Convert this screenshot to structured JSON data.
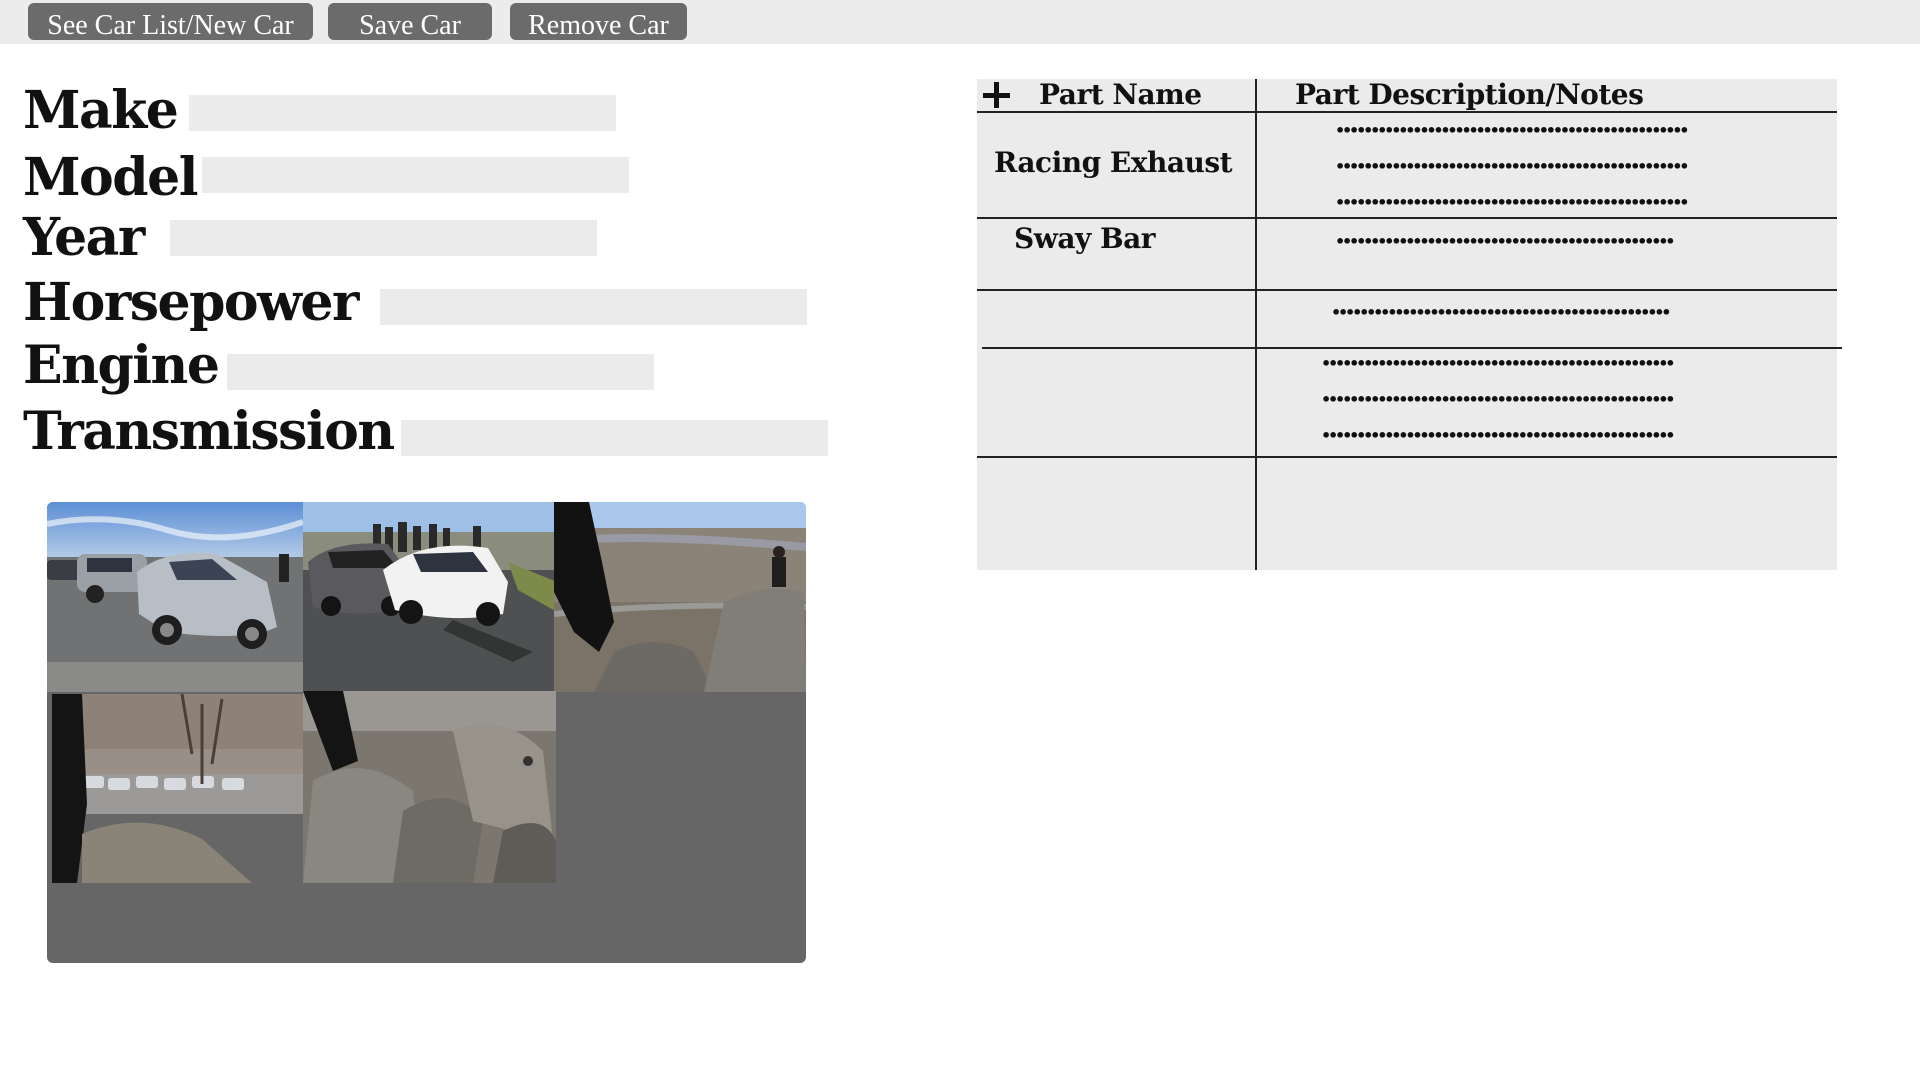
{
  "toolbar": {
    "see_car_list_label": "See Car List/New Car",
    "save_car_label": "Save Car",
    "remove_car_label": "Remove Car",
    "button_color": "#6b6b6b"
  },
  "fields": [
    {
      "label": "Make",
      "value": ""
    },
    {
      "label": "Model",
      "value": ""
    },
    {
      "label": "Year",
      "value": ""
    },
    {
      "label": "Horsepower",
      "value": ""
    },
    {
      "label": "Engine",
      "value": ""
    },
    {
      "label": "Transmission",
      "value": ""
    }
  ],
  "gallery": {
    "photos": [
      {
        "name": "photo-parked-cars-hatchback"
      },
      {
        "name": "photo-sports-cars-overlook"
      },
      {
        "name": "photo-rocky-overlook-valley"
      },
      {
        "name": "photo-overlook-parking"
      },
      {
        "name": "photo-boulders"
      }
    ]
  },
  "parts_table": {
    "add_icon": "plus-icon",
    "header_part_name": "Part Name",
    "header_description": "Part Description/Notes",
    "rows": [
      {
        "part_name": "Racing Exhaust",
        "notes": [
          "••••••••••••••••••••••••••••••••••••••••••••••••••",
          "••••••••••••••••••••••••••••••••••••••••••••••••••",
          "••••••••••••••••••••••••••••••••••••••••••••••••••"
        ]
      },
      {
        "part_name": "Sway Bar",
        "notes": [
          "••••••••••••••••••••••••••••••••••••••••••••••••"
        ]
      },
      {
        "part_name": "",
        "notes": [
          "••••••••••••••••••••••••••••••••••••••••••••••••"
        ]
      },
      {
        "part_name": "",
        "notes": [
          "••••••••••••••••••••••••••••••••••••••••••••••••••",
          "••••••••••••••••••••••••••••••••••••••••••••••••••",
          "••••••••••••••••••••••••••••••••••••••••••••••••••"
        ]
      },
      {
        "part_name": "",
        "notes": []
      }
    ]
  }
}
